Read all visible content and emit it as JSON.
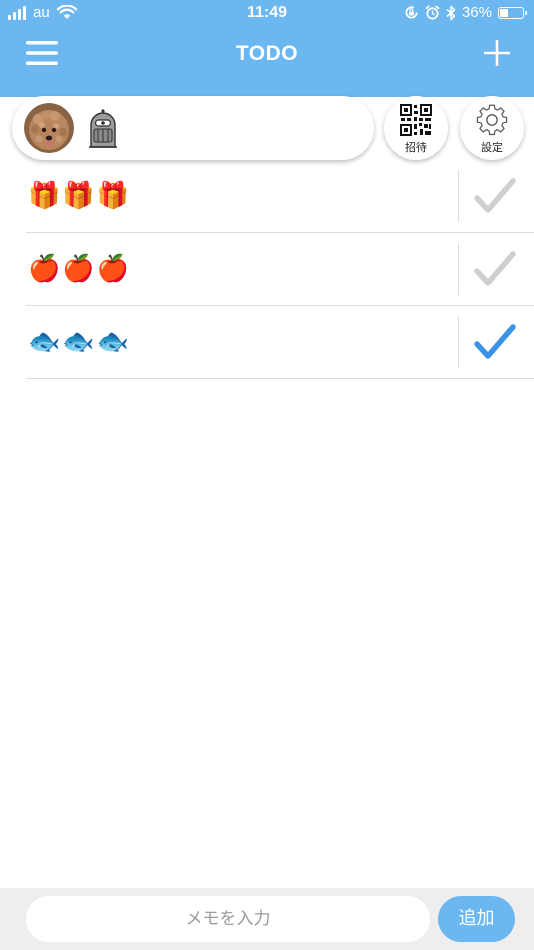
{
  "status_bar": {
    "carrier": "au",
    "time": "11:49",
    "battery_percent": "36%",
    "battery_level": 0.36,
    "icons": [
      "signal-icon",
      "wifi-icon",
      "rotation-lock-icon",
      "alarm-icon",
      "bluetooth-icon",
      "battery-icon"
    ]
  },
  "header": {
    "title": "TODO",
    "menu_icon": "hamburger-menu-icon",
    "add_icon": "plus-icon"
  },
  "members": {
    "avatars": [
      "dog-avatar",
      "robot-avatar"
    ]
  },
  "actions": {
    "invite_label": "招待",
    "invite_icon": "qr-code-icon",
    "settings_label": "設定",
    "settings_icon": "gear-icon"
  },
  "todos": [
    {
      "text": "🎁🎁🎁",
      "done": false
    },
    {
      "text": "🍎🍎🍎",
      "done": false
    },
    {
      "text": "🐟🐟🐟",
      "done": true
    }
  ],
  "colors": {
    "accent": "#6cb7f0",
    "check_done": "#3a93e6",
    "check_pending": "#cfcfcf"
  },
  "input": {
    "placeholder": "メモを入力",
    "value": "",
    "add_label": "追加"
  }
}
